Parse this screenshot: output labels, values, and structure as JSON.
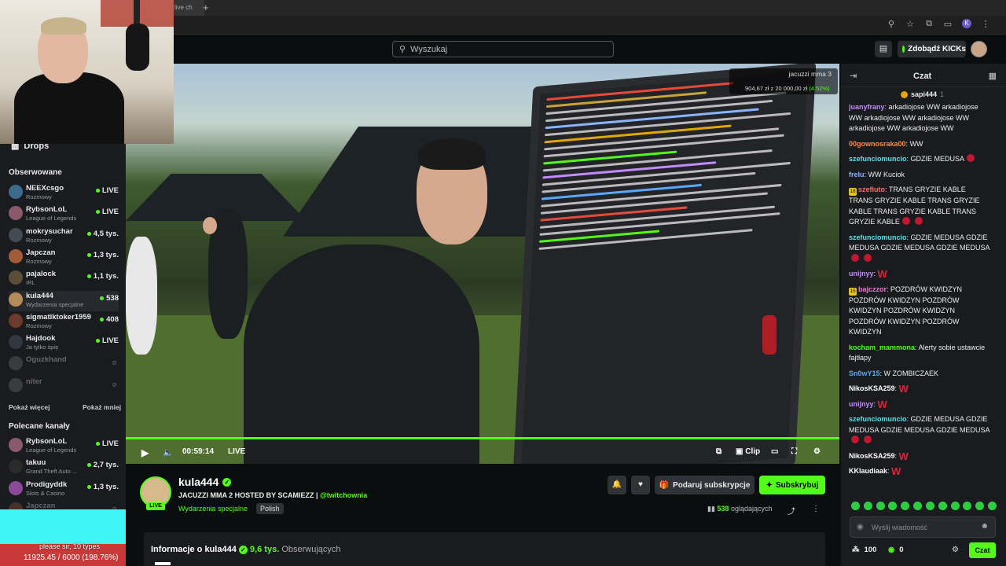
{
  "browser": {
    "tab_title": "live ch"
  },
  "search": {
    "placeholder": "Wyszukaj"
  },
  "header": {
    "kicks_button": "Zdobądź KICKs"
  },
  "sidebar": {
    "drops_label": "Drops",
    "following_title": "Obserwowane",
    "following": [
      {
        "name": "NEEXcsgo",
        "category": "Rozmowy",
        "viewers": "LIVE",
        "color": "#3c6a8c"
      },
      {
        "name": "RybsonLoL",
        "category": "League of Legends",
        "viewers": "LIVE",
        "color": "#8a5a6a"
      },
      {
        "name": "mokrysuchar",
        "category": "Rozmowy",
        "viewers": "4,5 tys.",
        "color": "#444a52"
      },
      {
        "name": "Japczan",
        "category": "Rozmowy",
        "viewers": "1,3 tys.",
        "color": "#a15c3a"
      },
      {
        "name": "pajalock",
        "category": "IRL",
        "viewers": "1,1 tys.",
        "color": "#5a4d3a"
      },
      {
        "name": "kula444",
        "category": "Wydarzenia specjalne",
        "viewers": "538",
        "color": "#b48c5a"
      },
      {
        "name": "sigmatiktoker1959",
        "category": "Rozmowy",
        "viewers": "408",
        "color": "#6e3a2e"
      },
      {
        "name": "Hajdook",
        "category": "Ja tylko śpię",
        "viewers": "LIVE",
        "color": "#333840"
      },
      {
        "name": "Oguzkhand",
        "category": "",
        "viewers": "",
        "color": "#777"
      },
      {
        "name": "niter",
        "category": "",
        "viewers": "",
        "color": "#777"
      }
    ],
    "show_more": "Pokaż więcej",
    "show_less": "Pokaż mniej",
    "recommended_title": "Polecane kanały",
    "recommended": [
      {
        "name": "RybsonLoL",
        "category": "League of Legends",
        "viewers": "LIVE",
        "color": "#8a5a6a"
      },
      {
        "name": "takuu",
        "category": "Grand Theft Auto ...",
        "viewers": "2,7 tys.",
        "color": "#2a2a2a"
      },
      {
        "name": "Prodigyddk",
        "category": "Slots & Casino",
        "viewers": "1,3 tys.",
        "color": "#8a4a9a"
      },
      {
        "name": "Japczan",
        "category": "",
        "viewers": "",
        "color": "#a15c3a"
      }
    ]
  },
  "overlay": {
    "goal_label": "please sir, 10 types",
    "goal_value": "11925.45 / 6000 (198.76%)"
  },
  "video_overlay": {
    "title": "jacuzzi mma 3",
    "value": "904,67 zł z 20 000,00 zł",
    "pct": "(4.52%)"
  },
  "player": {
    "time": "00:59:14",
    "live": "LIVE",
    "clip": "Clip",
    "progress": 1.0
  },
  "channel": {
    "name": "kula444",
    "title": "JACUZZI MMA 2 HOSTED BY SCAMIEZZ | ",
    "handle": "@twitchownia",
    "category": "Wydarzenia specjalne",
    "language": "Polish",
    "live_badge": "LIVE",
    "gift_button": "Podaruj subskrypcje",
    "subscribe_button": "Subskrybuj",
    "viewers_count": "538",
    "viewers_label": "oglądających"
  },
  "about": {
    "prefix": "Informacje o kula444",
    "followers": "9,6 tys.",
    "followers_label": "Obserwujących"
  },
  "chat": {
    "title": "Czat",
    "pinned_user": "sapi444",
    "pinned_count": "1",
    "messages": [
      {
        "user": "juanyfrany",
        "color": "#c28cff",
        "text": "arkadiojose WW arkadiojose WW arkadiojose WW arkadiojose WW arkadiojose WW arkadiojose WW"
      },
      {
        "user": "00gownosraka00",
        "color": "#ff8a3d",
        "text": "WW"
      },
      {
        "user": "szefunciomuncio",
        "color": "#5ce1e6",
        "text": "GDZIE MEDUSA",
        "emotes": 1
      },
      {
        "user": "frelu",
        "color": "#8ab4ff",
        "text": "WW Kuciok"
      },
      {
        "user": "szefiuto",
        "color": "#ff6b6b",
        "badge": "18",
        "text": "TRANS GRYZIE KABLE TRANS GRYZIE KABLE TRANS GRYZIE KABLE TRANS GRYZIE KABLE TRANS GRYZIE KABLE",
        "emotes": 2
      },
      {
        "user": "szefunciomuncio",
        "color": "#5ce1e6",
        "text": "GDZIE MEDUSA GDZIE MEDUSA GDZIE MEDUSA GDZIE MEDUSA",
        "emotes": 2
      },
      {
        "user": "unijnyy",
        "color": "#c28cff",
        "text": "",
        "w": "W"
      },
      {
        "user": "bajczzor",
        "color": "#ff6bd6",
        "badge": "15",
        "text": "POZDRÓW KWIDZYN POZDRÓW KWIDZYN POZDRÓW KWIDZYN POZDRÓW KWIDZYN POZDRÓW KWIDZYN POZDRÓW KWIDZYN"
      },
      {
        "user": "kocham_mammona",
        "color": "#53fc18",
        "text": "Alerty sobie ustawcie fajtłapy"
      },
      {
        "user": "Sn0wY15",
        "color": "#5aa9ff",
        "text": "W ZOMBICZAEK"
      },
      {
        "user": "NikosKSA259",
        "color": "#ffffff",
        "text": "",
        "w": "W"
      },
      {
        "user": "unijnyy",
        "color": "#c28cff",
        "text": "",
        "w": "W"
      },
      {
        "user": "szefunciomuncio",
        "color": "#5ce1e6",
        "text": "GDZIE MEDUSA GDZIE MEDUSA GDZIE MEDUSA GDZIE MEDUSA",
        "emotes": 2
      },
      {
        "user": "NikosKSA259",
        "color": "#ffffff",
        "text": "",
        "w": "W"
      },
      {
        "user": "KKlaudiaak",
        "color": "#ffffff",
        "text": "",
        "w": "W"
      }
    ],
    "input_placeholder": "Wyślij wiadomość",
    "points": "100",
    "kicks": "0",
    "send_button": "Czat"
  }
}
